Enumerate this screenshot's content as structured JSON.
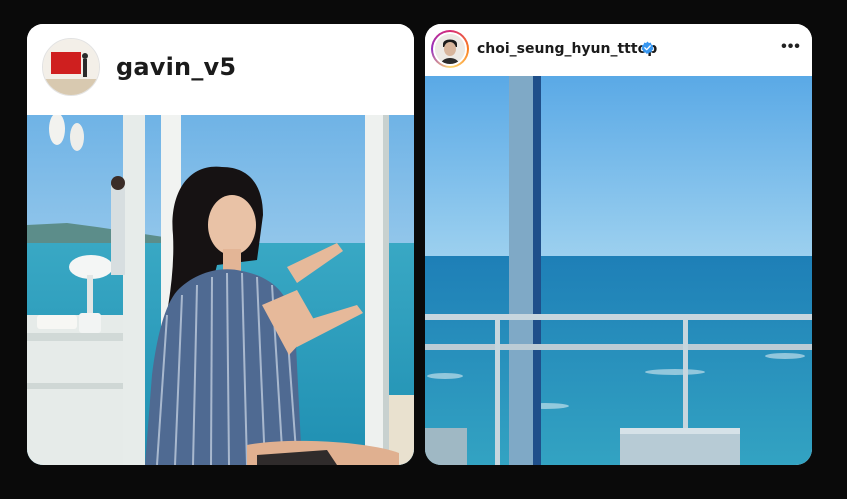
{
  "posts": [
    {
      "username": "gavin_v5",
      "avatar_icon": "red-painting-avatar",
      "photo_description_icon": "photo-woman-by-window-sea"
    },
    {
      "username": "choi_seung_hyun_tttop",
      "verified": true,
      "avatar_icon": "man-portrait-avatar",
      "more_icon": "more-options-icon",
      "photo_description_icon": "photo-sea-view-balcony"
    }
  ],
  "colors": {
    "sea": "#2f9fc0",
    "sky": "#6cb6e6",
    "verified_badge": "#3897f0"
  }
}
